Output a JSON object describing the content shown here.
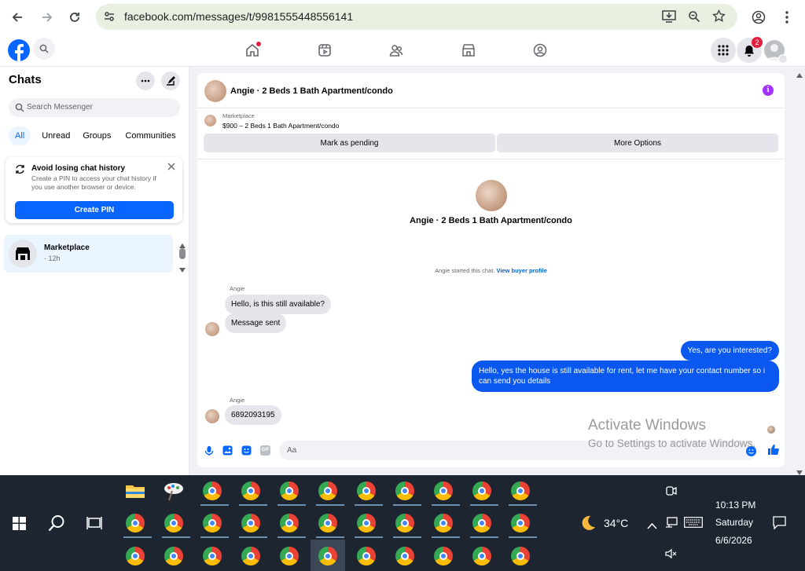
{
  "browser": {
    "url": "facebook.com/messages/t/9981555448556141"
  },
  "header": {
    "notification_count": "2"
  },
  "sidebar": {
    "title": "Chats",
    "search_placeholder": "Search Messenger",
    "filters": [
      "All",
      "Unread",
      "Groups",
      "Communities"
    ],
    "pin_card": {
      "title": "Avoid losing chat history",
      "body": "Create a PIN to access your chat history if you use another browser or device.",
      "button": "Create PIN"
    },
    "conversations": [
      {
        "name": "Marketplace",
        "time": "· 12h"
      }
    ]
  },
  "chat": {
    "title": "Angie · 2 Beds 1 Bath Apartment/condo",
    "listing_label": "Marketplace",
    "listing_title": "$900 – 2 Beds 1 Bath Apartment/condo",
    "mark_pending": "Mark as pending",
    "more_options": "More Options",
    "profile_name": "Angie · 2 Beds 1 Bath Apartment/condo",
    "started_text": "Angie started this chat.",
    "view_profile": "View buyer profile",
    "messages": [
      {
        "sender": "Angie",
        "text": "Hello, is this still available?",
        "direction": "in"
      },
      {
        "text": "Message sent",
        "direction": "in"
      },
      {
        "text": "Yes, are you interested?",
        "direction": "out"
      },
      {
        "text": "Hello, yes the house is still available for rent, let me have your contact number so i can send you details",
        "direction": "out"
      },
      {
        "sender": "Angie",
        "text": "6892093195",
        "direction": "in"
      }
    ],
    "composer_placeholder": "Aa"
  },
  "watermark": {
    "title": "Activate Windows",
    "subtitle": "Go to Settings to activate Windows."
  },
  "taskbar": {
    "temperature": "34°C",
    "time": "10:13 PM",
    "day": "Saturday",
    "date": "6/6/2026"
  },
  "colors": {
    "fb_blue": "#0866ff",
    "bubble_out": "#0a58f0",
    "taskbar": "#1d2630"
  }
}
